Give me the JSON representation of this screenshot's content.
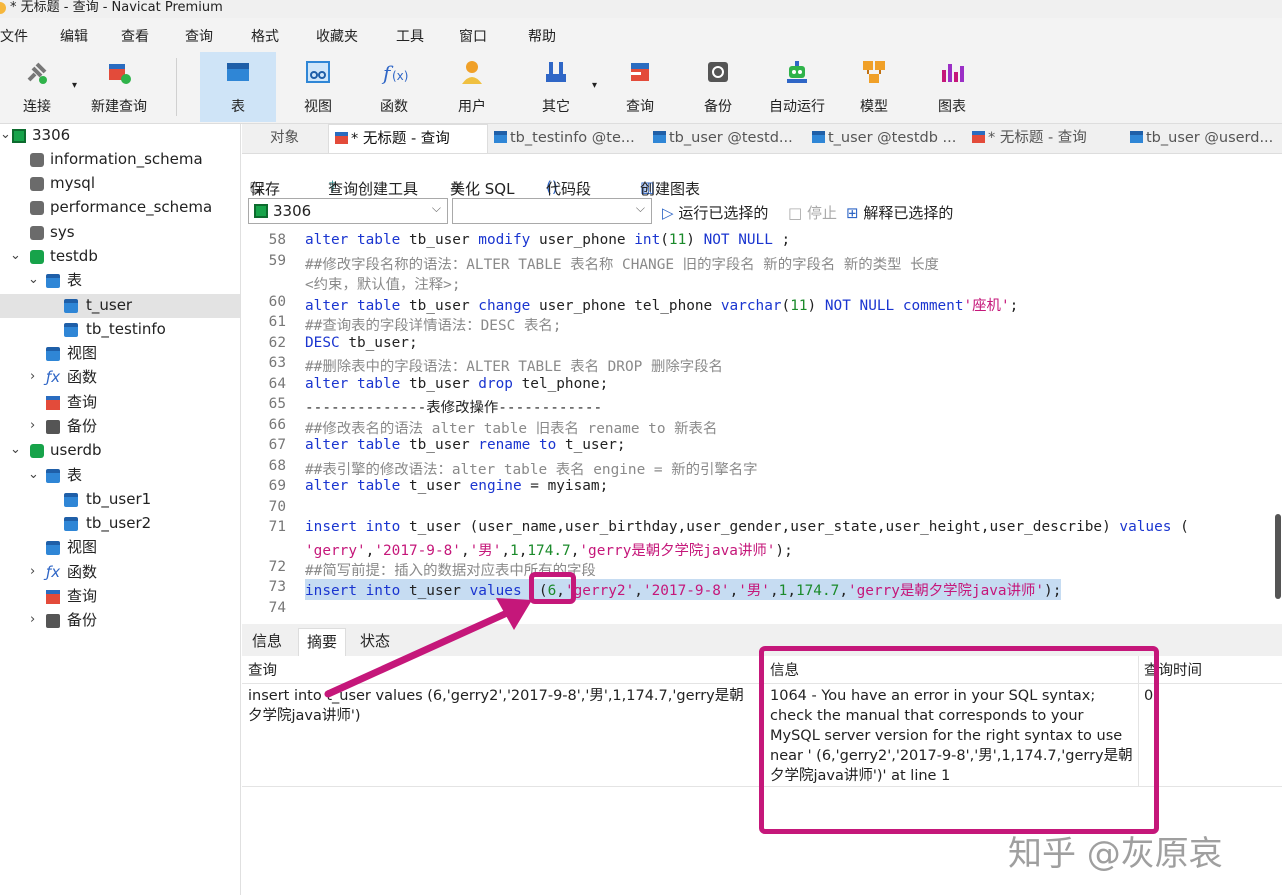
{
  "window": {
    "title": "* 无标题 - 查询 - Navicat Premium"
  },
  "menu": [
    "文件",
    "编辑",
    "查看",
    "查询",
    "格式",
    "收藏夹",
    "工具",
    "窗口",
    "帮助"
  ],
  "toolbar": [
    {
      "label": "连接",
      "icon": "plug-icon"
    },
    {
      "label": "新建查询",
      "icon": "new-query-icon"
    },
    {
      "label": "表",
      "icon": "table-icon"
    },
    {
      "label": "视图",
      "icon": "view-icon"
    },
    {
      "label": "函数",
      "icon": "function-icon"
    },
    {
      "label": "用户",
      "icon": "user-icon"
    },
    {
      "label": "其它",
      "icon": "other-icon"
    },
    {
      "label": "查询",
      "icon": "query-icon"
    },
    {
      "label": "备份",
      "icon": "backup-icon"
    },
    {
      "label": "自动运行",
      "icon": "robot-icon"
    },
    {
      "label": "模型",
      "icon": "model-icon"
    },
    {
      "label": "图表",
      "icon": "chart-icon"
    }
  ],
  "tree": {
    "connection": "3306",
    "dbs": [
      "information_schema",
      "mysql",
      "performance_schema",
      "sys"
    ],
    "testdb": {
      "name": "testdb",
      "tables_label": "表",
      "tables": [
        "t_user",
        "tb_testinfo"
      ],
      "view": "视图",
      "func": "函数",
      "query": "查询",
      "backup": "备份"
    },
    "userdb": {
      "name": "userdb",
      "tables_label": "表",
      "tables": [
        "tb_user1",
        "tb_user2"
      ],
      "view": "视图",
      "func": "函数",
      "query": "查询",
      "backup": "备份"
    }
  },
  "tabs": [
    "对象",
    "* 无标题 - 查询",
    "tb_testinfo @te...",
    "tb_user @testd...",
    "t_user @testdb ...",
    "* 无标题 - 查询",
    "tb_user @userd..."
  ],
  "query_toolbar": {
    "save": "保存",
    "builder": "查询创建工具",
    "beautify": "美化 SQL",
    "snippet": "代码段",
    "chart": "创建图表"
  },
  "query_bar": {
    "connection": "3306",
    "database": "",
    "run": "运行已选择的",
    "stop": "停止",
    "explain": "解释已选择的"
  },
  "editor": {
    "lines": [
      {
        "n": "58",
        "text": "alter table tb_user modify user_phone int(11) NOT NULL ;"
      },
      {
        "n": "59",
        "text": "##修改字段名称的语法：ALTER TABLE 表名称 CHANGE 旧的字段名 新的字段名 新的类型 长度"
      },
      {
        "n": "",
        "text": "<约束，默认值，注释>;"
      },
      {
        "n": "60",
        "text": "alter table tb_user change user_phone tel_phone varchar(11) NOT NULL comment'座机';"
      },
      {
        "n": "61",
        "text": "##查询表的字段详情语法：DESC 表名;"
      },
      {
        "n": "62",
        "text": "DESC tb_user;"
      },
      {
        "n": "63",
        "text": "##删除表中的字段语法：ALTER TABLE 表名 DROP 删除字段名"
      },
      {
        "n": "64",
        "text": "alter table tb_user drop tel_phone;"
      },
      {
        "n": "65",
        "text": "--------------表修改操作------------"
      },
      {
        "n": "66",
        "text": "##修改表名的语法 alter table 旧表名 rename to 新表名"
      },
      {
        "n": "67",
        "text": "alter table tb_user rename to t_user;"
      },
      {
        "n": "68",
        "text": "##表引擎的修改语法：alter table 表名 engine = 新的引擎名字"
      },
      {
        "n": "69",
        "text": "alter table t_user engine = myisam;"
      },
      {
        "n": "70",
        "text": ""
      },
      {
        "n": "71",
        "text": "insert into t_user (user_name,user_birthday,user_gender,user_state,user_height,user_describe) values ("
      },
      {
        "n": "",
        "text": "'gerry','2017-9-8','男',1,174.7,'gerry是朝夕学院java讲师');"
      },
      {
        "n": "72",
        "text": "##简写前提：插入的数据对应表中所有的字段"
      },
      {
        "n": "73",
        "text": "insert into t_user values  (6,'gerry2','2017-9-8','男',1,174.7,'gerry是朝夕学院java讲师');"
      },
      {
        "n": "74",
        "text": ""
      }
    ]
  },
  "result_tabs": [
    "信息",
    "摘要",
    "状态"
  ],
  "result": {
    "headers": [
      "查询",
      "信息",
      "查询时间"
    ],
    "query": "insert into t_user values  (6,'gerry2','2017-9-8','男',1,174.7,'gerry是朝夕学院java讲师')",
    "message": "1064 - You have an error in your SQL syntax; check the manual that corresponds to your MySQL server version for the right syntax to use near '  (6,'gerry2','2017-9-8','男',1,174.7,'gerry是朝夕学院java讲师')' at line 1",
    "time": "0."
  },
  "watermark": "知乎 @灰原哀",
  "colors": {
    "highlight": "#c5177a",
    "keyword": "#1a35d0",
    "string": "#c5177a",
    "comment": "#8a8a8a",
    "number": "#1a8a2a"
  }
}
